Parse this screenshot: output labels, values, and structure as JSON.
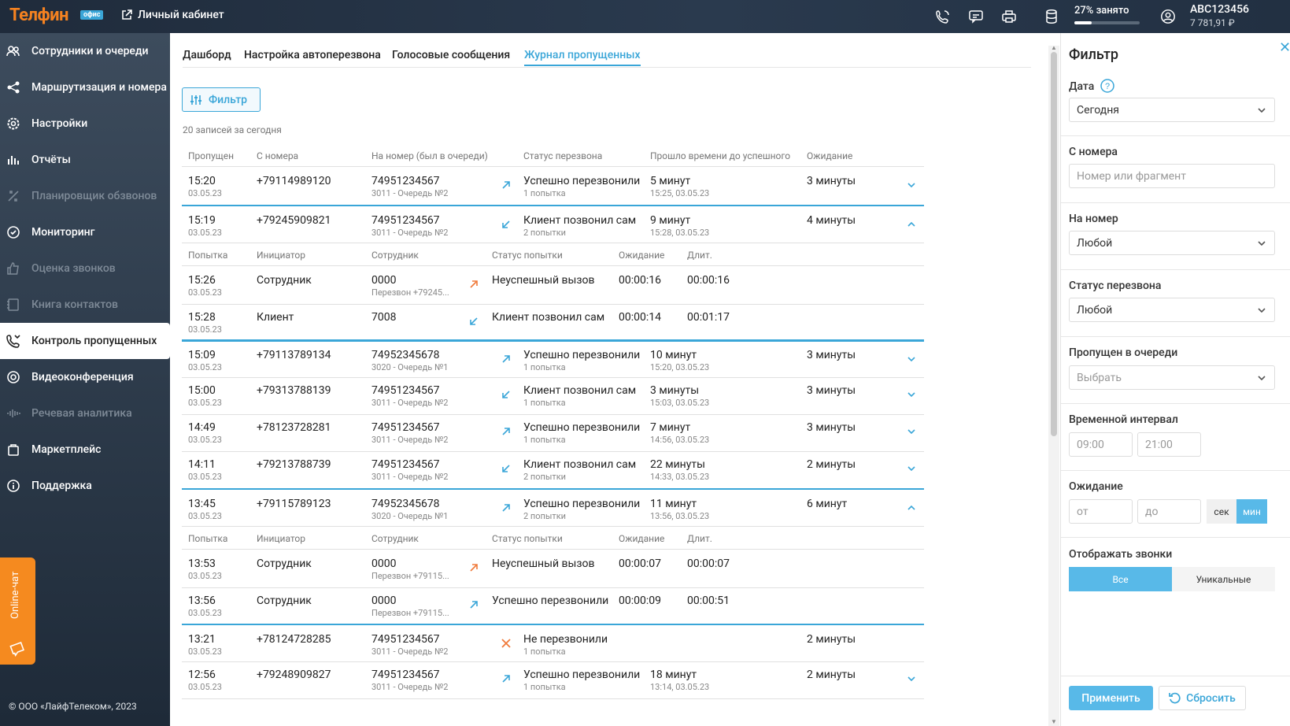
{
  "header": {
    "logo": "Телфин",
    "logo_badge": "офис",
    "cabinet_label": "Личный кабинет",
    "storage_label": "27% занято",
    "storage_percent": 27,
    "account_name": "ABC123456",
    "account_balance": "7 781,91 ₽"
  },
  "sidebar": {
    "items": [
      {
        "label": "Сотрудники и очереди"
      },
      {
        "label": "Маршрутизация и номера"
      },
      {
        "label": "Настройки"
      },
      {
        "label": "Отчёты"
      },
      {
        "label": "Планировщик обзвонов"
      },
      {
        "label": "Мониторинг"
      },
      {
        "label": "Оценка звонков"
      },
      {
        "label": "Книга контактов"
      },
      {
        "label": "Контроль пропущенных"
      },
      {
        "label": "Видеоконференция"
      },
      {
        "label": "Речевая аналитика"
      },
      {
        "label": "Маркетплейс"
      },
      {
        "label": "Поддержка"
      }
    ],
    "chat_label": "Online-чат",
    "copyright": "© ООО «ЛайфТелеком», 2023"
  },
  "tabs": [
    "Дашборд",
    "Настройка автоперезвона",
    "Голосовые сообщения",
    "Журнал пропущенных"
  ],
  "filter_button": "Фильтр",
  "count_text": "20 записей за сегодня",
  "table": {
    "headers": [
      "Пропущен",
      "С номера",
      "На номер (был в очереди)",
      "Статус перезвона",
      "Прошло времени до успешного",
      "Ожидание"
    ],
    "sub_headers": [
      "Попытка",
      "Инициатор",
      "Сотрудник",
      "Статус попытки",
      "Ожидание",
      "Длит."
    ],
    "rows": [
      {
        "time": "15:20",
        "date": "03.05.23",
        "from": "+79114989120",
        "to": "74951234567",
        "queue": "3011 - Очередь №2",
        "status": "Успешно перезвонили",
        "attempts": "1 попытка",
        "elapsed": "5 минут",
        "elapsed_at": "15:25, 03.05.23",
        "wait": "3 минуты"
      },
      {
        "time": "15:19",
        "date": "03.05.23",
        "from": "+79245909821",
        "to": "74951234567",
        "queue": "3011 - Очередь №2",
        "status": "Клиент позвонил сам",
        "attempts": "2 попытки",
        "elapsed": "9 минут",
        "elapsed_at": "15:28, 03.05.23",
        "wait": "4 минуты"
      },
      {
        "time": "15:09",
        "date": "03.05.23",
        "from": "+79113789134",
        "to": "74952345678",
        "queue": "3020 - Очередь №1",
        "status": "Успешно перезвонили",
        "attempts": "1 попытка",
        "elapsed": "10 минут",
        "elapsed_at": "15:20, 03.05.23",
        "wait": "3 минуты"
      },
      {
        "time": "15:00",
        "date": "03.05.23",
        "from": "+79313788139",
        "to": "74951234567",
        "queue": "3011 - Очередь №2",
        "status": "Клиент позвонил сам",
        "attempts": "1 попытка",
        "elapsed": "3 минуты",
        "elapsed_at": "15:03, 03.05.23",
        "wait": "3 минуты"
      },
      {
        "time": "14:49",
        "date": "03.05.23",
        "from": "+78123728281",
        "to": "74951234567",
        "queue": "3011 - Очередь №2",
        "status": "Успешно перезвонили",
        "attempts": "1 попытка",
        "elapsed": "7 минут",
        "elapsed_at": "14:56, 03.05.23",
        "wait": "3 минуты"
      },
      {
        "time": "14:11",
        "date": "03.05.23",
        "from": "+79213788739",
        "to": "74951234567",
        "queue": "3011 - Очередь №2",
        "status": "Клиент позвонил сам",
        "attempts": "2 попытки",
        "elapsed": "22 минуты",
        "elapsed_at": "14:33, 03.05.23",
        "wait": "2 минуты"
      },
      {
        "time": "13:45",
        "date": "03.05.23",
        "from": "+79115789123",
        "to": "74952345678",
        "queue": "3020 - Очередь №1",
        "status": "Успешно перезвонили",
        "attempts": "2 попытки",
        "elapsed": "11 минут",
        "elapsed_at": "13:56, 03.05.23",
        "wait": "6 минут"
      },
      {
        "time": "13:21",
        "date": "03.05.23",
        "from": "+78124728285",
        "to": "74951234567",
        "queue": "3011 - Очередь №2",
        "status": "Не перезвонили",
        "attempts": "1 попытка",
        "elapsed": "",
        "elapsed_at": "",
        "wait": "2 минуты"
      },
      {
        "time": "12:56",
        "date": "03.05.23",
        "from": "+79248909827",
        "to": "74951234567",
        "queue": "3011 - Очередь №2",
        "status": "Успешно перезвонили",
        "attempts": "1 попытка",
        "elapsed": "18 минут",
        "elapsed_at": "13:14, 03.05.23",
        "wait": "2 минуты"
      }
    ],
    "sub_rows": [
      {
        "time": "15:26",
        "date": "03.05.23",
        "initiator": "Сотрудник",
        "employee": "0000",
        "employee_sub": "Перезвон +79245...",
        "status": "Неуспешный вызов",
        "wait": "00:00:16",
        "dur": "00:00:16"
      },
      {
        "time": "15:28",
        "date": "03.05.23",
        "initiator": "Клиент",
        "employee": "7008",
        "employee_sub": "",
        "status": "Клиент позвонил сам",
        "wait": "00:00:14",
        "dur": "00:01:17"
      },
      {
        "time": "13:53",
        "date": "03.05.23",
        "initiator": "Сотрудник",
        "employee": "0000",
        "employee_sub": "Перезвон +79115...",
        "status": "Неуспешный вызов",
        "wait": "00:00:07",
        "dur": "00:00:07"
      },
      {
        "time": "13:56",
        "date": "03.05.23",
        "initiator": "Сотрудник",
        "employee": "0000",
        "employee_sub": "Перезвон +79115...",
        "status": "Успешно перезвонили",
        "wait": "00:00:09",
        "dur": "00:00:51"
      }
    ]
  },
  "filter": {
    "title": "Фильтр",
    "date_label": "Дата",
    "date_value": "Сегодня",
    "from_label": "С номера",
    "from_placeholder": "Номер или фрагмент",
    "to_label": "На номер",
    "to_value": "Любой",
    "status_label": "Статус перезвона",
    "status_value": "Любой",
    "queue_label": "Пропущен в очереди",
    "queue_value": "Выбрать",
    "interval_label": "Временной интервал",
    "interval_from": "09:00",
    "interval_to": "21:00",
    "wait_label": "Ожидание",
    "wait_from": "от",
    "wait_to": "до",
    "unit_sec": "сек",
    "unit_min": "мин",
    "show_label": "Отображать звонки",
    "show_all": "Все",
    "show_unique": "Уникальные",
    "apply": "Применить",
    "reset": "Сбросить"
  },
  "colors": {
    "accent": "#3aa6d8",
    "orange": "#f58220",
    "red": "#f07a3a"
  }
}
